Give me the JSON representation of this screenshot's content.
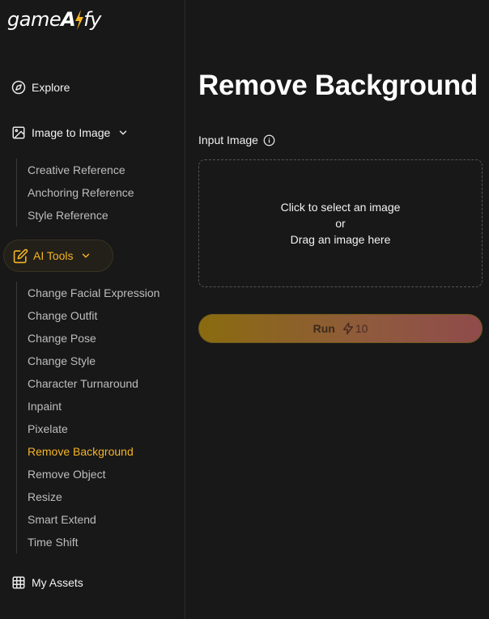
{
  "logo": {
    "pre": "game",
    "ai": "AI",
    "post": "fy"
  },
  "sidebar": {
    "explore": {
      "label": "Explore",
      "icon": "compass-icon"
    },
    "image_to_image": {
      "label": "Image to Image",
      "icon": "image-icon",
      "items": [
        "Creative Reference",
        "Anchoring Reference",
        "Style Reference"
      ]
    },
    "ai_tools": {
      "label": "AI Tools",
      "icon": "edit-icon",
      "items": [
        "Change Facial Expression",
        "Change Outfit",
        "Change Pose",
        "Change Style",
        "Character Turnaround",
        "Inpaint",
        "Pixelate",
        "Remove Background",
        "Remove Object",
        "Resize",
        "Smart Extend",
        "Time Shift"
      ],
      "active_item": "Remove Background"
    },
    "my_assets": {
      "label": "My Assets",
      "icon": "grid-icon"
    }
  },
  "main": {
    "title": "Remove Background",
    "input_label": "Input Image",
    "dropzone": {
      "line1": "Click to select an image",
      "line2": "or",
      "line3": "Drag an image here"
    },
    "run": {
      "label": "Run",
      "cost": "10"
    }
  },
  "colors": {
    "accent": "#f5b325",
    "background": "#181818"
  }
}
